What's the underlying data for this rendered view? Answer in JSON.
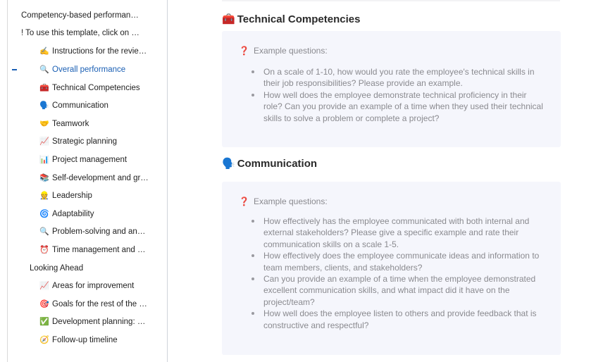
{
  "sidebar": {
    "items": [
      {
        "level": 0,
        "emoji": "",
        "label": "Competency-based performan…",
        "active": false
      },
      {
        "level": 0,
        "emoji": "",
        "label": "! To use this template, click on …",
        "active": false
      },
      {
        "level": 2,
        "emoji": "✍️",
        "label": "Instructions for the revie…",
        "active": false
      },
      {
        "level": 2,
        "emoji": "🔍",
        "label": "Overall performance",
        "active": true
      },
      {
        "level": 2,
        "emoji": "🧰",
        "label": "Technical Competencies",
        "active": false
      },
      {
        "level": 2,
        "emoji": "🗣️",
        "label": "Communication",
        "active": false
      },
      {
        "level": 2,
        "emoji": "🤝",
        "label": "Teamwork",
        "active": false
      },
      {
        "level": 2,
        "emoji": "📈",
        "label": "Strategic planning",
        "active": false
      },
      {
        "level": 2,
        "emoji": "📊",
        "label": "Project management",
        "active": false
      },
      {
        "level": 2,
        "emoji": "📚",
        "label": "Self-development and gr…",
        "active": false
      },
      {
        "level": 2,
        "emoji": "👷",
        "label": "Leadership",
        "active": false
      },
      {
        "level": 2,
        "emoji": "🌀",
        "label": "Adaptability",
        "active": false
      },
      {
        "level": 2,
        "emoji": "🔍",
        "label": "Problem-solving and an…",
        "active": false
      },
      {
        "level": 2,
        "emoji": "⏰",
        "label": "Time management and …",
        "active": false
      },
      {
        "level": 1,
        "emoji": "",
        "label": "Looking Ahead",
        "active": false
      },
      {
        "level": 2,
        "emoji": "📈",
        "label": "Areas for improvement",
        "active": false
      },
      {
        "level": 2,
        "emoji": "🎯",
        "label": "Goals for the rest of the …",
        "active": false
      },
      {
        "level": 2,
        "emoji": "✅",
        "label": "Development planning: …",
        "active": false
      },
      {
        "level": 2,
        "emoji": "🧭",
        "label": "Follow-up timeline",
        "active": false
      }
    ],
    "active_color": "#1a5fb4"
  },
  "main": {
    "sections": [
      {
        "emoji": "🧰",
        "title": "Technical Competencies",
        "callout_icon": "❓",
        "callout_heading": "Example questions:",
        "questions": [
          "On a scale of 1-10, how would you rate the employee's technical skills in their job responsibilities? Please provide an example.",
          "How well does the employee demonstrate technical proficiency in their role? Can you provide an example of a time when they used their technical skills to solve a problem or complete a project?"
        ]
      },
      {
        "emoji": "🗣️",
        "title": "Communication",
        "callout_icon": "❓",
        "callout_heading": "Example questions:",
        "questions": [
          "How effectively has the employee communicated with both internal and external stakeholders? Please give a specific example and rate their communication skills on a scale 1-5.",
          "How effectively does the employee communicate ideas and information to team members, clients, and stakeholders?",
          "Can you provide an example of a time when the employee demonstrated excellent communication skills, and what impact did it have on the project/team?",
          "How well does the employee listen to others and provide feedback that is constructive and respectful?"
        ]
      }
    ]
  }
}
